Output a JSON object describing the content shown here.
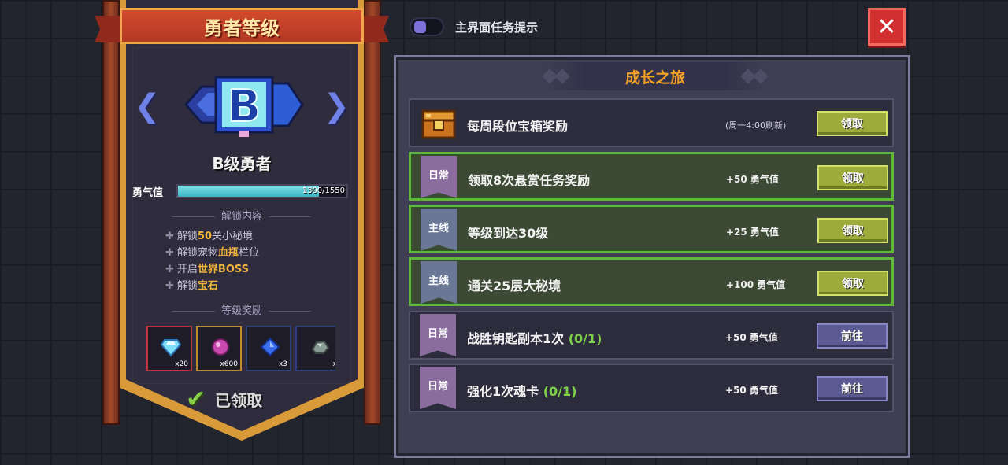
{
  "hero": {
    "title": "勇者等级",
    "rank_letter": "B",
    "rank_name": "B级勇者",
    "courage_label": "勇气值",
    "courage_current": 1300,
    "courage_max": 1550,
    "courage_text": "1300/1550",
    "unlock_title": "解锁内容",
    "unlocks": [
      {
        "pre": "解锁",
        "hl": "50",
        "post": "关小秘境"
      },
      {
        "pre": "解锁宠物",
        "hl": "血瓶",
        "post": "栏位"
      },
      {
        "pre": "开启",
        "hl": "世界BOSS",
        "post": ""
      },
      {
        "pre": "解锁",
        "hl": "宝石",
        "post": ""
      }
    ],
    "reward_title": "等级奖励",
    "rewards": [
      {
        "icon": "diamond-icon",
        "count": "x20",
        "border": "#c0333a"
      },
      {
        "icon": "pink-gem-icon",
        "count": "x600",
        "border": "#c28a2e"
      },
      {
        "icon": "blue-gem-icon",
        "count": "x3",
        "border": "#2c3f86"
      },
      {
        "icon": "ore-icon",
        "count": "x",
        "border": "#2c3f86"
      }
    ],
    "claimed_label": "已领取"
  },
  "topbar": {
    "toggle_label": "主界面任务提示",
    "toggle_on": false
  },
  "panel": {
    "title": "成长之旅",
    "weekly": {
      "name": "每周段位宝箱奖励",
      "note": "(周一4:00刷新)",
      "button": "领取"
    },
    "tasks": [
      {
        "tag": "日常",
        "type": "daily",
        "name": "领取8次悬赏任务奖励",
        "progress": "",
        "reward": "+50 勇气值",
        "button": "领取",
        "state": "claim"
      },
      {
        "tag": "主线",
        "type": "main",
        "name": "等级到达30级",
        "progress": "",
        "reward": "+25 勇气值",
        "button": "领取",
        "state": "claim"
      },
      {
        "tag": "主线",
        "type": "main",
        "name": "通关25层大秘境",
        "progress": "",
        "reward": "+100 勇气值",
        "button": "领取",
        "state": "claim"
      },
      {
        "tag": "日常",
        "type": "daily",
        "name": "战胜钥匙副本1次 ",
        "progress": "(0/1)",
        "reward": "+50 勇气值",
        "button": "前往",
        "state": "go"
      },
      {
        "tag": "日常",
        "type": "daily",
        "name": "强化1次魂卡 ",
        "progress": "(0/1)",
        "reward": "+50 勇气值",
        "button": "前往",
        "state": "go"
      }
    ]
  },
  "colors": {
    "accent_orange": "#f3a126",
    "active_green": "#5fb83c",
    "claim_button": "#9cab3a",
    "go_button": "#5b5a93",
    "close_red": "#d23030"
  }
}
